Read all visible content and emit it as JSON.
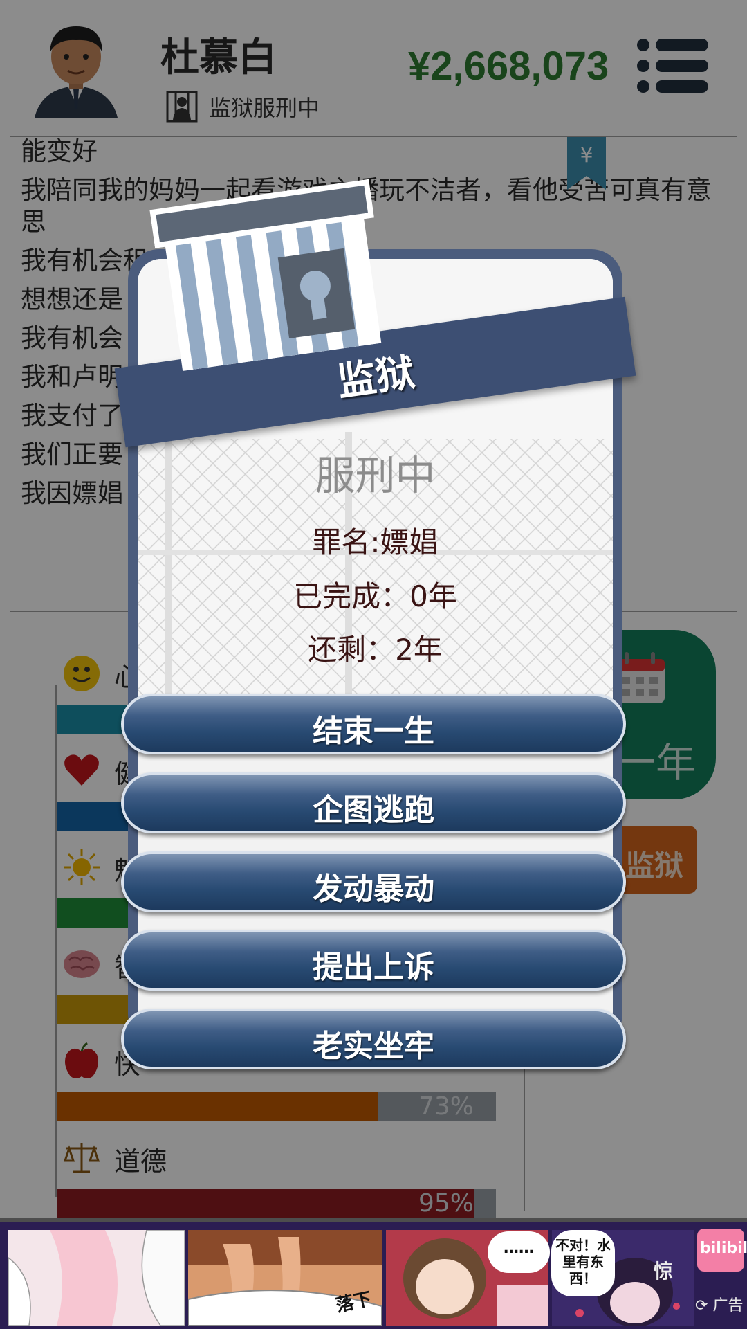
{
  "header": {
    "player_name": "杜慕白",
    "status": "监狱服刑中",
    "money": "¥2,668,073"
  },
  "log_lines": [
    "能变好",
    "我陪同我的妈妈一起看游戏主播玩不洁者，看他受苦可真有意思",
    "我有机会租",
    "想想还是",
    "我有机会",
    "我和卢明                                                              者，真是相逢恨晚",
    "我支付了",
    "我们正要                                                          警察...我被判处两",
    "我因嫖娼"
  ],
  "stats": [
    {
      "name": "心",
      "icon": "smiley-icon",
      "color": "#1a8fa8",
      "percent": null
    },
    {
      "name": "健",
      "icon": "heart-icon",
      "color": "#1565a8",
      "percent": null
    },
    {
      "name": "魅",
      "icon": "sun-icon",
      "color": "#1f8f3a",
      "percent": null
    },
    {
      "name": "智",
      "icon": "brain-icon",
      "color": "#c89a0a",
      "percent": null
    },
    {
      "name": "快",
      "icon": "apple-icon",
      "color": "#c25a00",
      "percent": "73%",
      "fill": 0.73
    },
    {
      "name": "道德",
      "icon": "scales-icon",
      "color": "#8f1c22",
      "percent": "95%",
      "fill": 0.95
    }
  ],
  "side_buttons": {
    "year": "一年",
    "prison": "监狱"
  },
  "modal": {
    "title": "监狱",
    "status": "服刑中",
    "crime": "罪名:嫖娼",
    "completed": "已完成：0年",
    "remaining": "还剩：2年",
    "actions": [
      "结束一生",
      "企图逃跑",
      "发动暴动",
      "提出上诉",
      "老实坐牢"
    ]
  },
  "ad": {
    "bubble_1": "……",
    "bubble_2": "不对！水里有东西！",
    "caption_1": "落下",
    "caption_2": "惊",
    "brand": "bilibili",
    "tag": "广告"
  },
  "bookmark": "¥"
}
